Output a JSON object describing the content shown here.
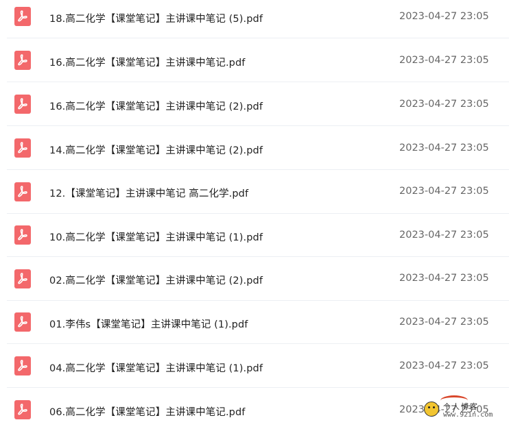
{
  "files": [
    {
      "name": "18.高二化学【课堂笔记】主讲课中笔记 (5).pdf",
      "date": "2023-04-27 23:05",
      "icon": "pdf-icon"
    },
    {
      "name": "16.高二化学【课堂笔记】主讲课中笔记.pdf",
      "date": "2023-04-27 23:05",
      "icon": "pdf-icon"
    },
    {
      "name": "16.高二化学【课堂笔记】主讲课中笔记 (2).pdf",
      "date": "2023-04-27 23:05",
      "icon": "pdf-icon"
    },
    {
      "name": "14.高二化学【课堂笔记】主讲课中笔记 (2).pdf",
      "date": "2023-04-27 23:05",
      "icon": "pdf-icon"
    },
    {
      "name": "12.【课堂笔记】主讲课中笔记 高二化学.pdf",
      "date": "2023-04-27 23:05",
      "icon": "pdf-icon"
    },
    {
      "name": "10.高二化学【课堂笔记】主讲课中笔记 (1).pdf",
      "date": "2023-04-27 23:05",
      "icon": "pdf-icon"
    },
    {
      "name": "02.高二化学【课堂笔记】主讲课中笔记 (2).pdf",
      "date": "2023-04-27 23:05",
      "icon": "pdf-icon"
    },
    {
      "name": "01.李伟s【课堂笔记】主讲课中笔记 (1).pdf",
      "date": "2023-04-27 23:05",
      "icon": "pdf-icon"
    },
    {
      "name": "04.高二化学【课堂笔记】主讲课中笔记 (1).pdf",
      "date": "2023-04-27 23:05",
      "icon": "pdf-icon"
    },
    {
      "name": "06.高二化学【课堂笔记】主讲课中笔记.pdf",
      "date": "2023-04-27 23:05",
      "icon": "pdf-icon"
    }
  ],
  "watermark": {
    "title": "个人博客",
    "url": "www.92in.com"
  },
  "colors": {
    "pdf_icon": "#f3686b",
    "text": "#222222",
    "date": "#666666",
    "separator": "#eceff3"
  }
}
